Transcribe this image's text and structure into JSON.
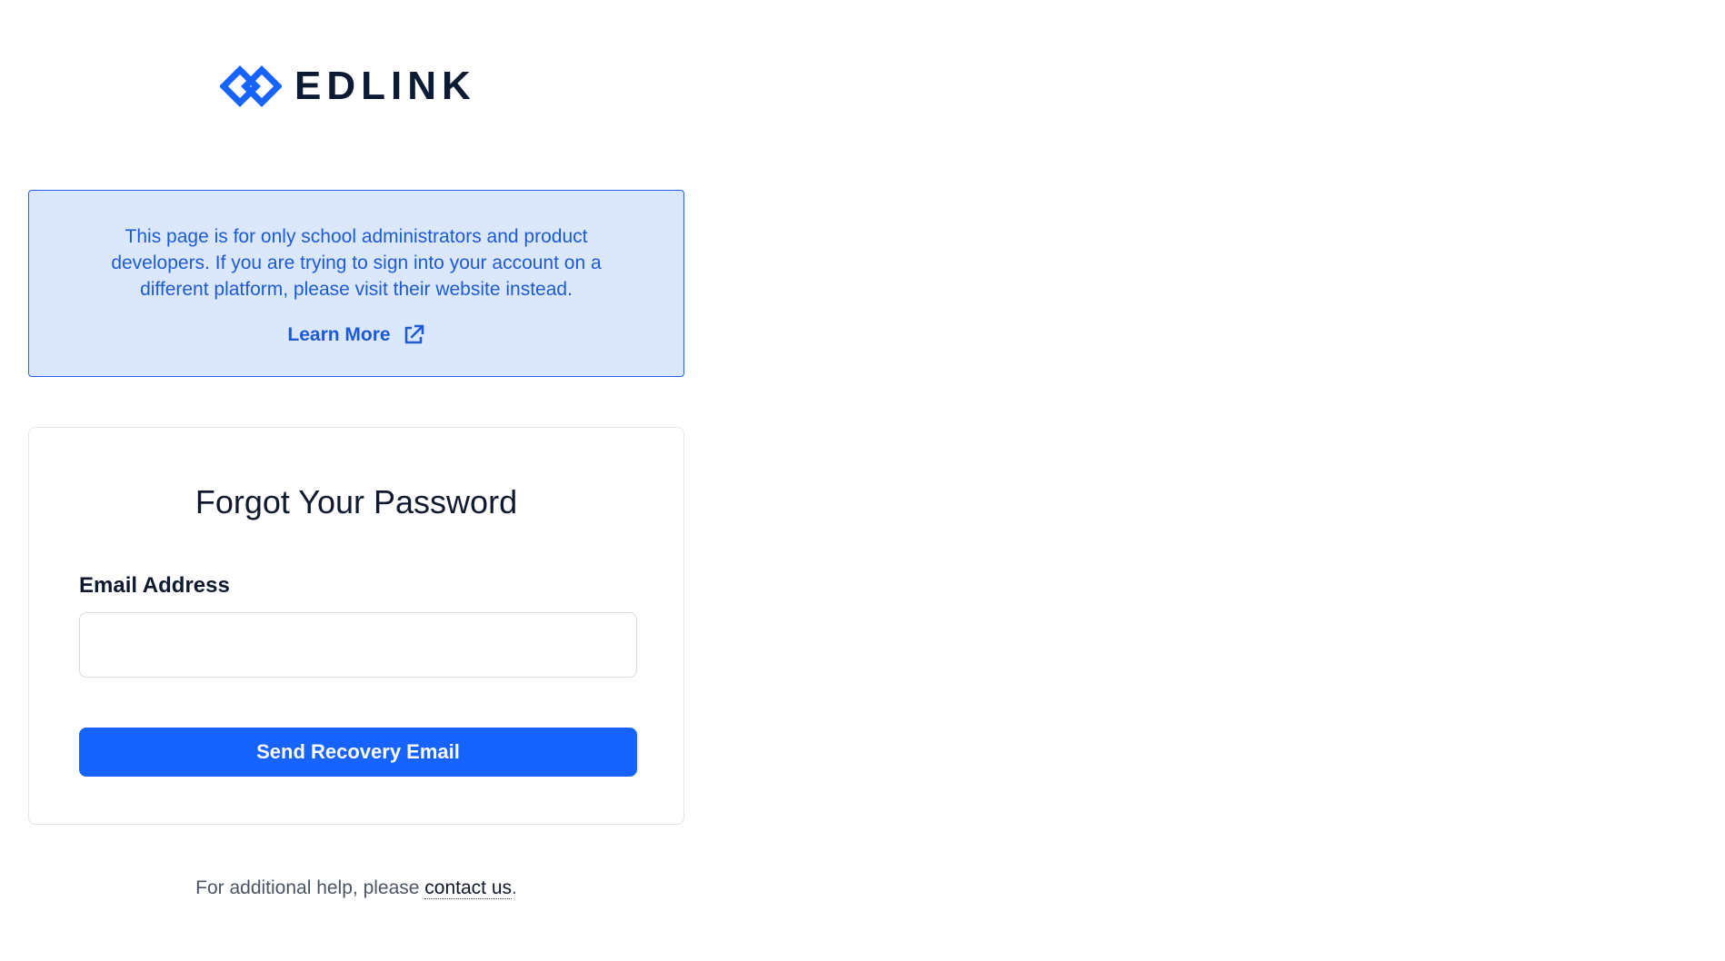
{
  "brand": {
    "name": "EDLINK",
    "accent_color": "#1663ff"
  },
  "notice": {
    "text": "This page is for only school administrators and product developers. If you are trying to sign into your account on a different platform, please visit their website instead.",
    "learn_more": "Learn More",
    "icon": "external-link-icon"
  },
  "form": {
    "title": "Forgot Your Password",
    "email_label": "Email Address",
    "email_value": "",
    "submit_label": "Send Recovery Email"
  },
  "footer": {
    "help_prefix": "For additional help, please ",
    "contact_link": "contact us",
    "help_suffix": "."
  }
}
